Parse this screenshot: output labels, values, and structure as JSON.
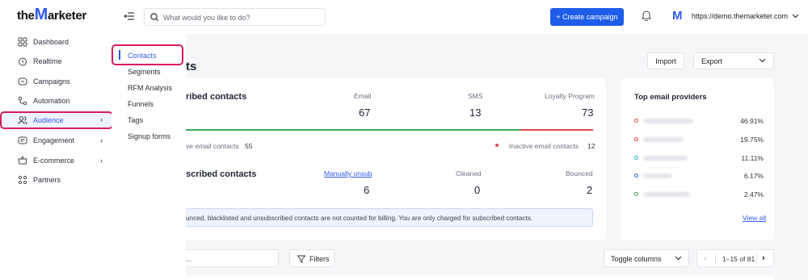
{
  "brand": {
    "logo_before": "the",
    "logo_m": "M",
    "logo_after": "arketer"
  },
  "search": {
    "placeholder": "What would you like to do?"
  },
  "header": {
    "create_label": "+ Create campaign",
    "account_logo": "M",
    "account_url": "https://demo.themarketer.com",
    "accent": "#1f5de8"
  },
  "sidebar": {
    "items": [
      {
        "label": "Dashboard",
        "icon": "grid-icon"
      },
      {
        "label": "Realtime",
        "icon": "clock-icon"
      },
      {
        "label": "Campaigns",
        "icon": "message-icon"
      },
      {
        "label": "Automation",
        "icon": "flow-icon"
      },
      {
        "label": "Audience",
        "icon": "users-icon",
        "active": true
      },
      {
        "label": "Engagement",
        "icon": "chat-icon"
      },
      {
        "label": "E-commerce",
        "icon": "basket-icon"
      },
      {
        "label": "Partners",
        "icon": "partners-icon"
      }
    ],
    "highlight_color": "#d81b60"
  },
  "submenu": {
    "items": [
      "Contacts",
      "Segments",
      "RFM Analysis",
      "Funnels",
      "Tags",
      "Signup forms"
    ],
    "active": "Contacts"
  },
  "main": {
    "title_partial": "ts",
    "import_label": "Import",
    "export_label": "Export",
    "subscribed": {
      "heading_partial": "ribed contacts",
      "columns": [
        {
          "label": "Email",
          "value": "67"
        },
        {
          "label": "SMS",
          "value": "13"
        },
        {
          "label": "Loyalty Program",
          "value": "73"
        }
      ],
      "active_label_partial": "ve email contacts",
      "active_value": "55",
      "inactive_label": "Inactive email contacts",
      "inactive_value": "12",
      "active_share": 0.8209,
      "active_color": "#3aa55d",
      "inactive_color": "#e5484d"
    },
    "unsubscribed": {
      "heading_partial": "scribed contacts",
      "columns": [
        {
          "label": "Manually unsub",
          "value": "6"
        },
        {
          "label": "Cleaned",
          "value": "0"
        },
        {
          "label": "Bounced",
          "value": "2"
        }
      ]
    },
    "notice": "unced, blacklisted and unsubscribed contacts are not counted for billing. You are only charged for subscribed contacts."
  },
  "providers": {
    "title": "Top email providers",
    "rows": [
      {
        "color": "#e5484d",
        "pct": "46.91%"
      },
      {
        "color": "#e5484d",
        "pct": "19.75%"
      },
      {
        "color": "#29b6d6",
        "pct": "11.11%"
      },
      {
        "color": "#2f5bea",
        "pct": "6.17%"
      },
      {
        "color": "#3aa55d",
        "pct": "2.47%"
      }
    ],
    "view_all": "View all"
  },
  "toolbar": {
    "search_partial": "...",
    "filters_label": "Filters",
    "toggle_label": "Toggle columns",
    "pager_info": "1–15 of 81",
    "prev": "‹",
    "next": "›"
  }
}
